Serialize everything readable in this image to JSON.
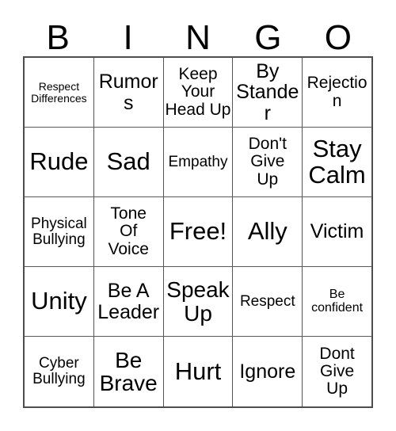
{
  "card": {
    "title": "BINGO",
    "header_letters": [
      "B",
      "I",
      "N",
      "G",
      "O"
    ],
    "free_space_label": "Free!",
    "columns": 5,
    "rows": 5,
    "colors": {
      "background": "#ffffff",
      "cell_background": "#ffffff",
      "text": "#000000",
      "outer_border": "#4d4d4d",
      "inner_border": "#595959"
    }
  },
  "grid": {
    "rows": [
      {
        "cells": [
          {
            "text": "Respect\nDifferences",
            "size": "xxs"
          },
          {
            "text": "Rumors",
            "size": "l"
          },
          {
            "text": "Keep\nYour\nHead Up",
            "size": "m"
          },
          {
            "text": "By\nStander",
            "size": "l"
          },
          {
            "text": "Rejection",
            "size": "m"
          }
        ]
      },
      {
        "cells": [
          {
            "text": "Rude",
            "size": "xxl"
          },
          {
            "text": "Sad",
            "size": "xxl"
          },
          {
            "text": "Empathy",
            "size": "s"
          },
          {
            "text": "Don't\nGive\nUp",
            "size": "m"
          },
          {
            "text": "Stay\nCalm",
            "size": "xxl"
          }
        ]
      },
      {
        "cells": [
          {
            "text": "Physical\nBullying",
            "size": "s"
          },
          {
            "text": "Tone\nOf\nVoice",
            "size": "m"
          },
          {
            "text": "Free!",
            "size": "xxl"
          },
          {
            "text": "Ally",
            "size": "xxl"
          },
          {
            "text": "Victim",
            "size": "l"
          }
        ]
      },
      {
        "cells": [
          {
            "text": "Unity",
            "size": "xxl"
          },
          {
            "text": "Be A\nLeader",
            "size": "l"
          },
          {
            "text": "Speak\nUp",
            "size": "xl"
          },
          {
            "text": "Respect",
            "size": "s"
          },
          {
            "text": "Be\nconfident",
            "size": "xs"
          }
        ]
      },
      {
        "cells": [
          {
            "text": "Cyber\nBullying",
            "size": "s"
          },
          {
            "text": "Be\nBrave",
            "size": "xl"
          },
          {
            "text": "Hurt",
            "size": "xxl"
          },
          {
            "text": "Ignore",
            "size": "l"
          },
          {
            "text": "Dont\nGive\nUp",
            "size": "m"
          }
        ]
      }
    ]
  }
}
